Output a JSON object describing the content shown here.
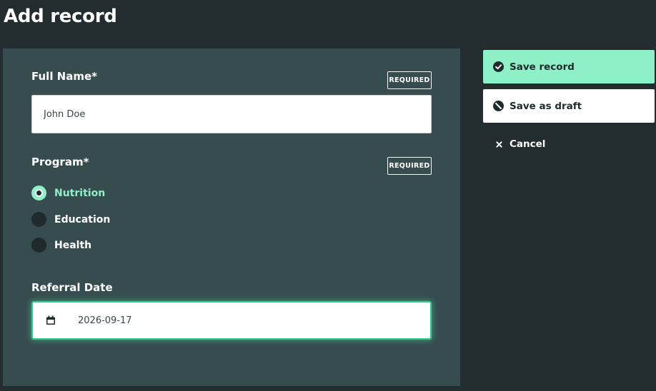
{
  "page": {
    "title": "Add record"
  },
  "form": {
    "full_name": {
      "label": "Full Name*",
      "badge": "REQUIRED",
      "value": "John Doe"
    },
    "program": {
      "label": "Program*",
      "badge": "REQUIRED",
      "options": [
        {
          "label": "Nutrition",
          "selected": true
        },
        {
          "label": "Education",
          "selected": false
        },
        {
          "label": "Health",
          "selected": false
        }
      ]
    },
    "referral_date": {
      "label": "Referral Date",
      "value": "2026-09-17",
      "icon": "calendar-icon"
    }
  },
  "actions": {
    "save": {
      "label": "Save record",
      "icon": "check-circle-icon"
    },
    "draft": {
      "label": "Save as draft",
      "icon": "draft-icon"
    },
    "cancel": {
      "label": "Cancel",
      "icon": "close-icon"
    }
  },
  "colors": {
    "background": "#232d2f",
    "panel": "#374c4f",
    "accent": "#8ef0c6",
    "focus_ring": "#2fd08c"
  }
}
